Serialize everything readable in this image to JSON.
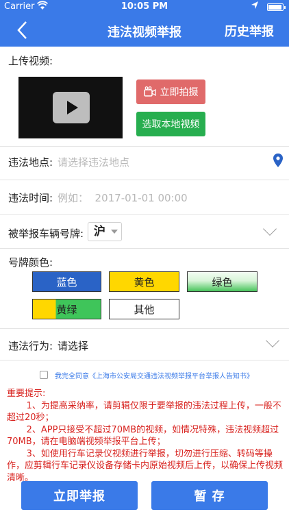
{
  "status_bar": {
    "carrier": "Carrier",
    "time": "10:05 PM"
  },
  "nav": {
    "title": "违法视频举报",
    "history_label": "历史举报"
  },
  "upload": {
    "label": "上传视频:",
    "shoot_button": "立即拍摄",
    "local_button": "选取本地视频"
  },
  "location": {
    "label": "违法地点:",
    "placeholder": "请选择违法地点"
  },
  "time_field": {
    "label": "违法时间:",
    "placeholder": "例如：  2017-01-01 00:00"
  },
  "plate": {
    "label": "被举报车辆号牌:",
    "province": "沪"
  },
  "plate_color": {
    "label": "号牌颜色:",
    "options": [
      "蓝色",
      "黄色",
      "绿色",
      "黄绿",
      "其他"
    ],
    "colors": {
      "blue": "#2a63c6",
      "yellow": "#ffd700",
      "green_light": "#e6f8e6",
      "green_dark": "#3fc55a",
      "other": "#ffffff"
    }
  },
  "behavior": {
    "label": "违法行为:",
    "value": "请选择"
  },
  "agreement": {
    "text": "我完全同意《上海市公安局交通违法视频举报平台举报人告知书》"
  },
  "notice": {
    "title": "重要提示:",
    "items": [
      "1、为提高采纳率，请剪辑仅限于要举报的违法过程上传，一般不超过20秒；",
      "2、APP只接受不超过70MB的视频，如情况特殊，违法视频超过70MB，请在电脑端视频举报平台上传；",
      "3、如使用行车记录仪视频进行举报，切勿进行压缩、转码等操作，应剪辑行车记录仪设备存储卡内原始视频后上传，以确保上传视频清晰。"
    ]
  },
  "actions": {
    "submit": "立即举报",
    "save": "暂 存"
  }
}
